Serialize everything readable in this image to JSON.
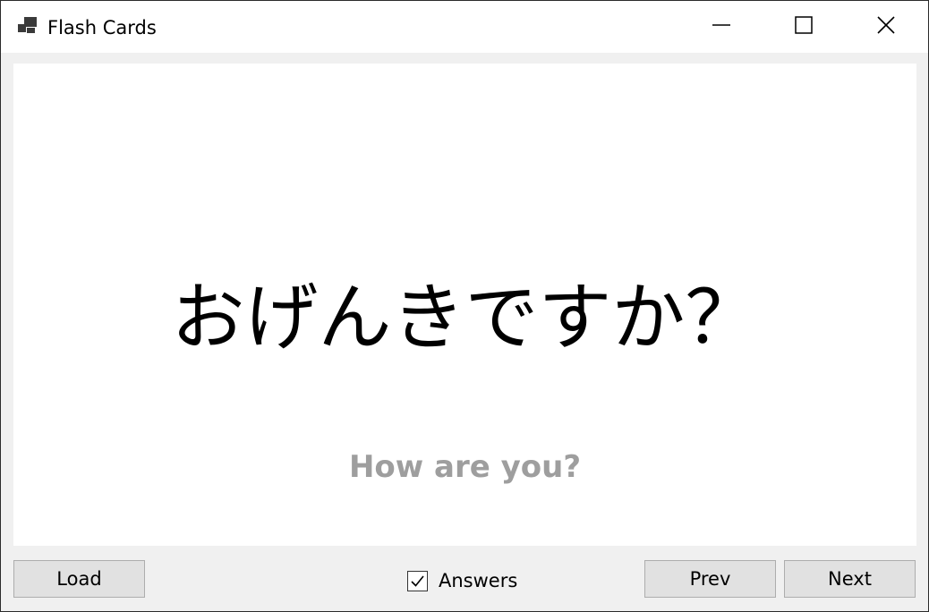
{
  "window": {
    "title": "Flash Cards",
    "icons": {
      "app": "app-icon",
      "minimize": "minimize-icon",
      "maximize": "maximize-icon",
      "close": "close-icon"
    }
  },
  "card": {
    "question": "おげんきですか？",
    "answer": "How are you?",
    "answer_color": "#9e9e9e"
  },
  "toolbar": {
    "load_label": "Load",
    "answers_label": "Answers",
    "answers_checked": true,
    "prev_label": "Prev",
    "next_label": "Next"
  }
}
